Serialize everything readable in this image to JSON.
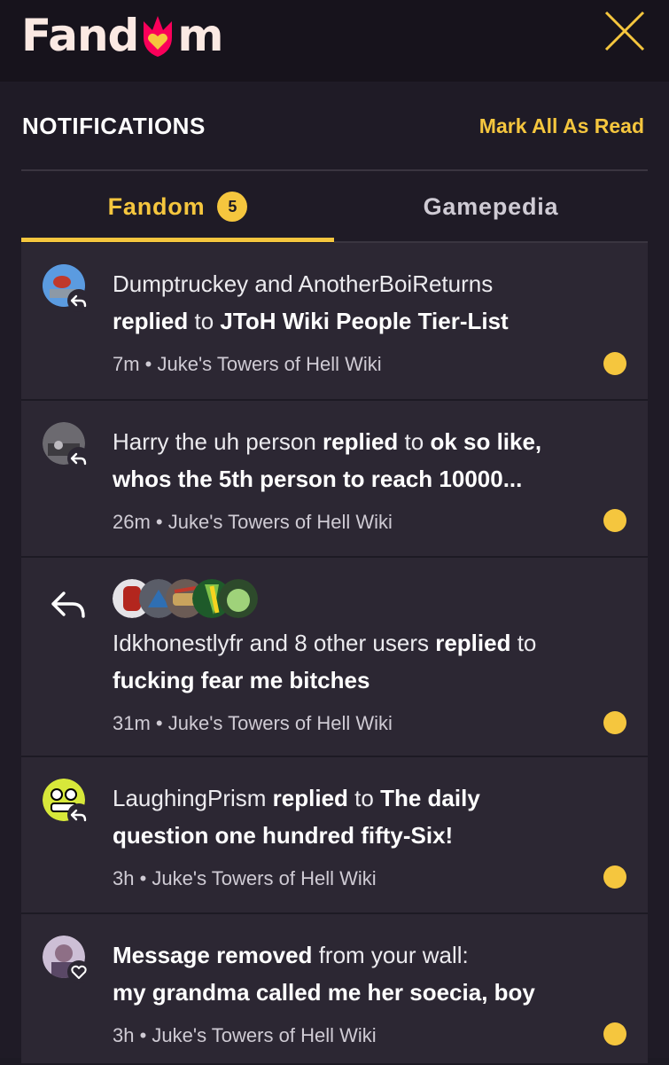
{
  "header": {
    "logo_text_left": "Fand",
    "logo_text_right": "m"
  },
  "panel": {
    "title": "NOTIFICATIONS",
    "mark_all": "Mark All As Read"
  },
  "tabs": [
    {
      "label": "Fandom",
      "badge": "5",
      "active": true
    },
    {
      "label": "Gamepedia",
      "active": false
    }
  ],
  "notifications": [
    {
      "actor": "Dumptruckey and AnotherBoiReturns",
      "verb": "replied",
      "prep": "to",
      "target_line1": "JToH Wiki People Tier-List",
      "time": "7m",
      "wiki": "Juke's Towers of Hell Wiki",
      "unread": true
    },
    {
      "actor": "Harry the uh person",
      "verb": "replied",
      "prep": "to",
      "target_line1": "ok so like,",
      "target_line2": "whos the 5th person to reach 10000...",
      "time": "26m",
      "wiki": "Juke's Towers of Hell Wiki",
      "unread": true
    },
    {
      "actor": "Idkhonestlyfr and 8 other users",
      "verb": "replied",
      "prep": "to",
      "target_line1": "fucking fear me bitches",
      "time": "31m",
      "wiki": "Juke's Towers of Hell Wiki",
      "unread": true
    },
    {
      "actor": "LaughingPrism",
      "verb": "replied",
      "prep": "to",
      "target_line1": "The daily",
      "target_line2": "question one hundred fifty-Six!",
      "time": "3h",
      "wiki": "Juke's Towers of Hell Wiki",
      "unread": true
    },
    {
      "lead": "Message removed",
      "rest": "from your wall:",
      "target_line1": "my grandma called me her soecia, boy",
      "time": "3h",
      "wiki": "Juke's Towers of Hell Wiki",
      "unread": true
    }
  ],
  "separator": " • ",
  "colors": {
    "accent": "#f5c63e",
    "background": "#1d1a24",
    "card": "#2c2733",
    "logo_heart": "#fa005a"
  }
}
